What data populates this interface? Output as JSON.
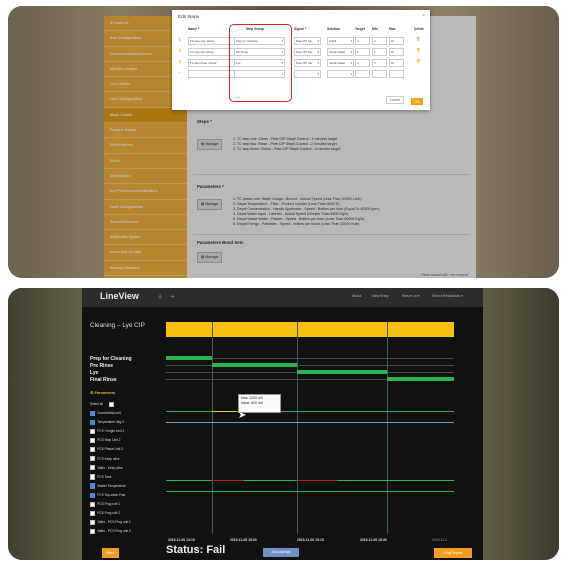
{
  "shot1": {
    "sidebar": [
      "IP Address",
      "Bus Configuration",
      "Communication Devices",
      "Machine Details",
      "Line Details",
      "Line Configuration",
      "Mode Details",
      "Product Details",
      "Shift Patterns",
      "Shifts",
      "Staff Names",
      "Key Performance Indicators",
      "Fault Configuration",
      "Stocked Devices",
      "Automatic Update",
      "Users and Groups",
      "Backup Database",
      "Setup Reporting",
      "Setup Events/Wdn"
    ],
    "active_index": 6,
    "modal": {
      "title": "Edit Steps",
      "close": "×",
      "columns": [
        "Name *",
        "Step Group",
        "Signal *",
        "Solution",
        "Target",
        "Min",
        "Max",
        "Delete"
      ],
      "rows": [
        {
          "name": "TC step one: Clean",
          "group": "Prep for Cleaning",
          "signal": "Pete CIP Ste",
          "solution": "Sol34",
          "target": "4",
          "min": "3",
          "max": "10"
        },
        {
          "name": "TC step two: Rinse",
          "group": "Pre Rinse",
          "signal": "Pete CIP Ste",
          "solution": "Sterile Water",
          "target": "2",
          "min": "1",
          "max": "10"
        },
        {
          "name": "TC step three: Check",
          "group": "Lye",
          "signal": "Pete CIP Ste",
          "solution": "Sterile Water",
          "target": "4",
          "min": "3",
          "max": "10"
        },
        {
          "name": "",
          "group": "",
          "signal": "",
          "solution": "",
          "target": "",
          "min": "",
          "max": ""
        }
      ],
      "cancel": "Cancel",
      "ok": "Ok"
    },
    "steps_title": "Steps *",
    "manage": "Manage",
    "steps": [
      "1. TC step one: Clean - Pete CIP Step0 Control - 4 minutes target",
      "2. TC step two: Rinse - Pete CIP Step0 Control - 2 minutes target",
      "3. TC step three: Check - Pete CIP Step0 Control - 4 minutes target"
    ],
    "params_title": "Parameters *",
    "params": [
      "1. TC param one: Water Usage - Bhome - Actual Speed (Less Than 30000 L/s/h)",
      "2. Depal Temperature - Filler - Product counter (Less Than 8000 K)",
      "3. Depal Concentration - Handle Applicator - Speed - Bottles per hour (Equal To 40000 ppm)",
      "4. Depal Water Input - Labeller - Actual Speed (Greater Than 6000 Kg/h)",
      "5. Depal Waste Water - Packer - Speed - Bottles per hour (Less Than 60000 Kg/h)",
      "6. Depal Energy - Palletiser - Speed - bottles per hours (Less Than 22000 Kwh)"
    ],
    "bend_title": "Parameters Bend Sets",
    "footnote": "Fields marked with * are required"
  },
  "shot2": {
    "logo": "LineView",
    "nav": [
      "About",
      "New Entry",
      "Return to ▾",
      "Select Resolution ▾"
    ],
    "header": "Cleaning – Lye CIP",
    "segments": [
      "Prep for Cleaning",
      "Pre Rinse",
      "Lye",
      "Final Rinse"
    ],
    "params_label": "Parameters",
    "select_all": "Select all",
    "params": [
      {
        "label": "Conductivity unit",
        "on": true
      },
      {
        "label": "Temperature deg C",
        "on": true
      },
      {
        "label": "PCS / height Unit 2",
        "on": false
      },
      {
        "label": "PCS Stop Unit 2",
        "on": false
      },
      {
        "label": "PCS Phase Unit 2",
        "on": false
      },
      {
        "label": "PCS Keep alive",
        "on": false
      },
      {
        "label": "Valbo - Keep alive",
        "on": false
      },
      {
        "label": "PCS Tank",
        "on": false
      },
      {
        "label": "Master Temperature",
        "on": true
      },
      {
        "label": "PCS Top-valve Fast",
        "on": true
      },
      {
        "label": "PCS Prog unit 1",
        "on": false
      },
      {
        "label": "PCS Prog unit 2",
        "on": false
      },
      {
        "label": "Valbo - PCS Prog unit 1",
        "on": false
      },
      {
        "label": "Valbo - PCS Prog unit 2",
        "on": false
      }
    ],
    "tooltip": [
      "Max: 1200 mS",
      "Value: 800 mS"
    ],
    "x_labels": [
      "2019-11-06 14:15",
      "2019-11-06 15:00",
      "2019-11-06 15:15",
      "2019-11-06 15:30",
      "2019-11-0"
    ],
    "back": "Back",
    "status": "Status: Fail",
    "acknowledge": "Acknowledge",
    "flag_report": "Flag Report"
  }
}
